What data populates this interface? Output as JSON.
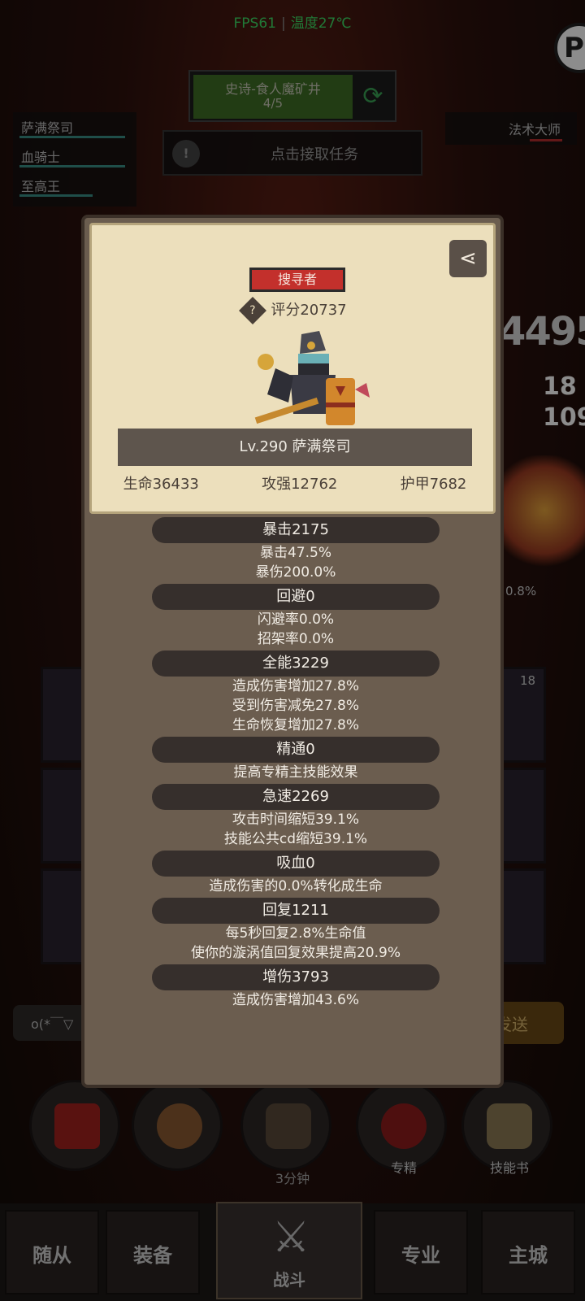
{
  "status": {
    "fps": "FPS61",
    "temp": "温度27℃"
  },
  "quest": {
    "name": "史诗-食人魔矿井",
    "progress": "4/5"
  },
  "task_bar": {
    "label": "点击接取任务"
  },
  "party": [
    "萨满祭司",
    "血骑士",
    "至高王"
  ],
  "enemy": {
    "name": "法术大师"
  },
  "background": {
    "big_number": "4495",
    "num1": "18",
    "num2": "109",
    "pct": "0.8%",
    "skill_count": "18",
    "chat_input": "o(*￣▽",
    "send": "发送"
  },
  "quick_actions": [
    {
      "label": "",
      "icon": "potion-icon"
    },
    {
      "label": "",
      "icon": "bread-icon"
    },
    {
      "label": "",
      "icon": "chest-icon"
    },
    {
      "label": "专精",
      "icon": "target-icon"
    },
    {
      "label": "技能书",
      "icon": "book-icon"
    }
  ],
  "chest_timer": "3分钟",
  "nav": [
    "随从",
    "装备",
    "战斗",
    "专业",
    "主城"
  ],
  "profile": {
    "title": "搜寻者",
    "score": "评分20737",
    "level_name": "Lv.290 萨满祭司",
    "core": [
      "生命36433",
      "攻强12762",
      "护甲7682"
    ],
    "stats": [
      {
        "head": "暴击2175",
        "lines": [
          "暴击47.5%",
          "暴伤200.0%"
        ]
      },
      {
        "head": "回避0",
        "lines": [
          "闪避率0.0%",
          "招架率0.0%"
        ]
      },
      {
        "head": "全能3229",
        "lines": [
          "造成伤害增加27.8%",
          "受到伤害减免27.8%",
          "生命恢复增加27.8%"
        ]
      },
      {
        "head": "精通0",
        "lines": [
          "提高专精主技能效果"
        ]
      },
      {
        "head": "急速2269",
        "lines": [
          "攻击时间缩短39.1%",
          "技能公共cd缩短39.1%"
        ]
      },
      {
        "head": "吸血0",
        "lines": [
          "造成伤害的0.0%转化成生命"
        ]
      },
      {
        "head": "回复1211",
        "lines": [
          "每5秒回复2.8%生命值",
          "使你的漩涡值回复效果提高20.9%"
        ]
      },
      {
        "head": "增伤3793",
        "lines": [
          "造成伤害增加43.6%"
        ]
      }
    ]
  },
  "colors": {
    "fps": "#3ddc64",
    "title_badge": "#c3302c",
    "party_bar": "#3a8f86",
    "enemy_bar": "#b52d2d"
  }
}
